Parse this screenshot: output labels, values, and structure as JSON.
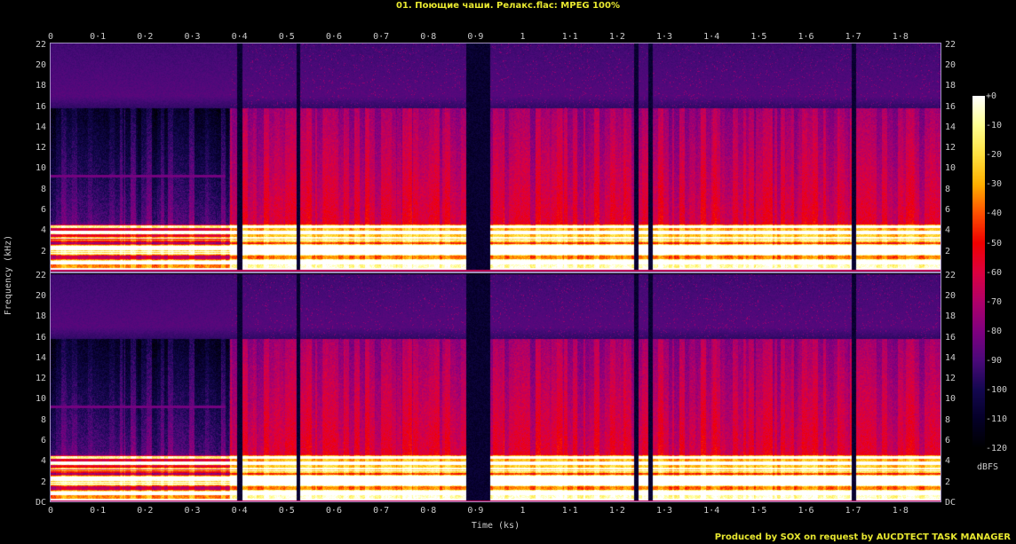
{
  "title": "01. Поющие чаши. Релакс.flac: MPEG 100%",
  "footer": "Produced by SOX on request by AUCDTECT TASK MANAGER",
  "chart_data": {
    "type": "heatmap",
    "title": "01. Поющие чаши. Релакс.flac: MPEG 100%",
    "xlabel": "Time (ks)",
    "ylabel": "Frequency (kHz)",
    "xlim": [
      0,
      1.885
    ],
    "ylim": [
      0,
      22.05
    ],
    "x_ticks": [
      "0",
      "0·1",
      "0·2",
      "0·3",
      "0·4",
      "0·5",
      "0·6",
      "0·7",
      "0·8",
      "0·9",
      "1",
      "1·1",
      "1·2",
      "1·3",
      "1·4",
      "1·5",
      "1·6",
      "1·7",
      "1·8"
    ],
    "x_tick_values": [
      0,
      0.1,
      0.2,
      0.3,
      0.4,
      0.5,
      0.6,
      0.7,
      0.8,
      0.9,
      1,
      1.1,
      1.2,
      1.3,
      1.4,
      1.5,
      1.6,
      1.7,
      1.8
    ],
    "y_ticks_top": [
      "22",
      "20",
      "18",
      "16",
      "14",
      "12",
      "10",
      "8",
      "6",
      "4",
      "2"
    ],
    "y_ticks_bottom": [
      "22",
      "20",
      "18",
      "16",
      "14",
      "12",
      "10",
      "8",
      "6",
      "4",
      "2",
      "DC"
    ],
    "y_tick_values": [
      22,
      20,
      18,
      16,
      14,
      12,
      10,
      8,
      6,
      4,
      2,
      0
    ],
    "channels": 2,
    "lowpass_cutoff_khz": 15.5,
    "colorbar": {
      "label": "dBFS",
      "ticks": [
        "+0",
        "-10",
        "-20",
        "-30",
        "-40",
        "-50",
        "-60",
        "-70",
        "-80",
        "-90",
        "-100",
        "-110",
        "-120"
      ],
      "range": [
        -120,
        0
      ]
    },
    "quiet_gaps_ks": [
      [
        0.395,
        0.405
      ],
      [
        0.52,
        0.528
      ],
      [
        0.88,
        0.93
      ],
      [
        1.235,
        1.245
      ],
      [
        1.265,
        1.275
      ],
      [
        1.695,
        1.705
      ]
    ],
    "loud_region_ks": [
      [
        0.38,
        1.885
      ]
    ]
  }
}
